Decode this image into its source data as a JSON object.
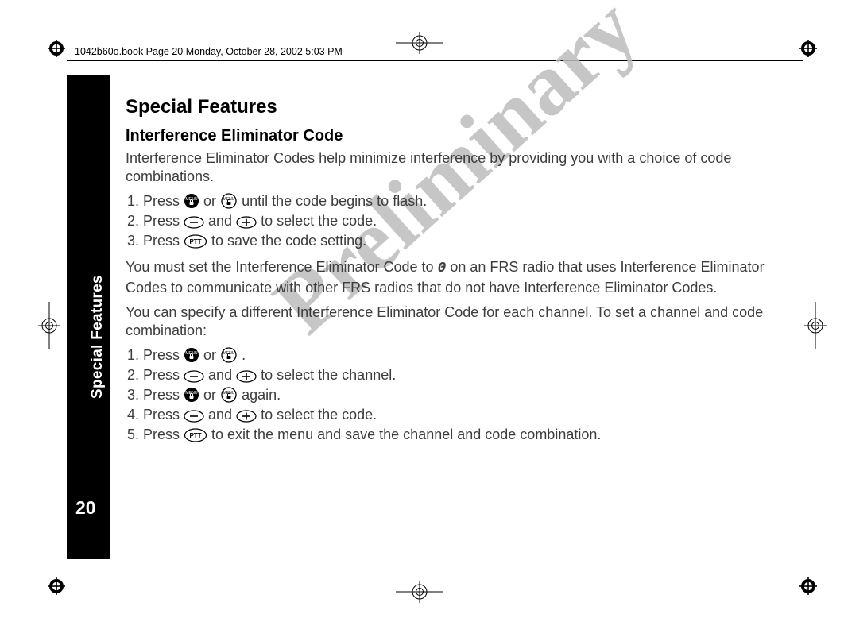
{
  "meta": {
    "bookline": "1042b60o.book  Page 20  Monday, October 28, 2002  5:03 PM",
    "watermark": "Preliminary"
  },
  "sidetab": {
    "label": "Special Features",
    "page_number": "20"
  },
  "content": {
    "heading": "Special Features",
    "subheading": "Interference Eliminator Code",
    "intro": "Interference Eliminator Codes help minimize interference by providing you with a choice of code combinations.",
    "steps1": {
      "s1a": "Press ",
      "s1b": " or ",
      "s1c": " until the code begins to flash.",
      "s2a": "Press  ",
      "s2b": " and  ",
      "s2c": " to select the code.",
      "s3a": "Press ",
      "s3b": "  to save the code setting."
    },
    "para2a": "You must set the Interference Eliminator Code to ",
    "glyph0": "0",
    "para2b": " on an FRS radio that uses Interference Eliminator Codes to communicate with other FRS radios that do not have Interference Eliminator Codes.",
    "para3": "You can specify a different Interference Eliminator Code for each channel. To set a channel and code combination:",
    "steps2": {
      "s1a": "Press ",
      "s1b": " or ",
      "s1c": ".",
      "s2a": "Press",
      "s2b": " and  ",
      "s2c": " to select the channel.",
      "s3a": "Press ",
      "s3b": " or ",
      "s3c": " again.",
      "s4a": "Press  ",
      "s4b": " and  ",
      "s4c": " to select the code.",
      "s5a": "Press  ",
      "s5b": "  to exit the menu and save the channel and code combination."
    }
  },
  "icons": {
    "menu_solid": "menu-lock-solid-icon",
    "menu_outline": "menu-lock-outline-icon",
    "minus_oval": "minus-oval-icon",
    "plus_oval": "plus-oval-icon",
    "ptt_oval": "ptt-oval-icon"
  }
}
